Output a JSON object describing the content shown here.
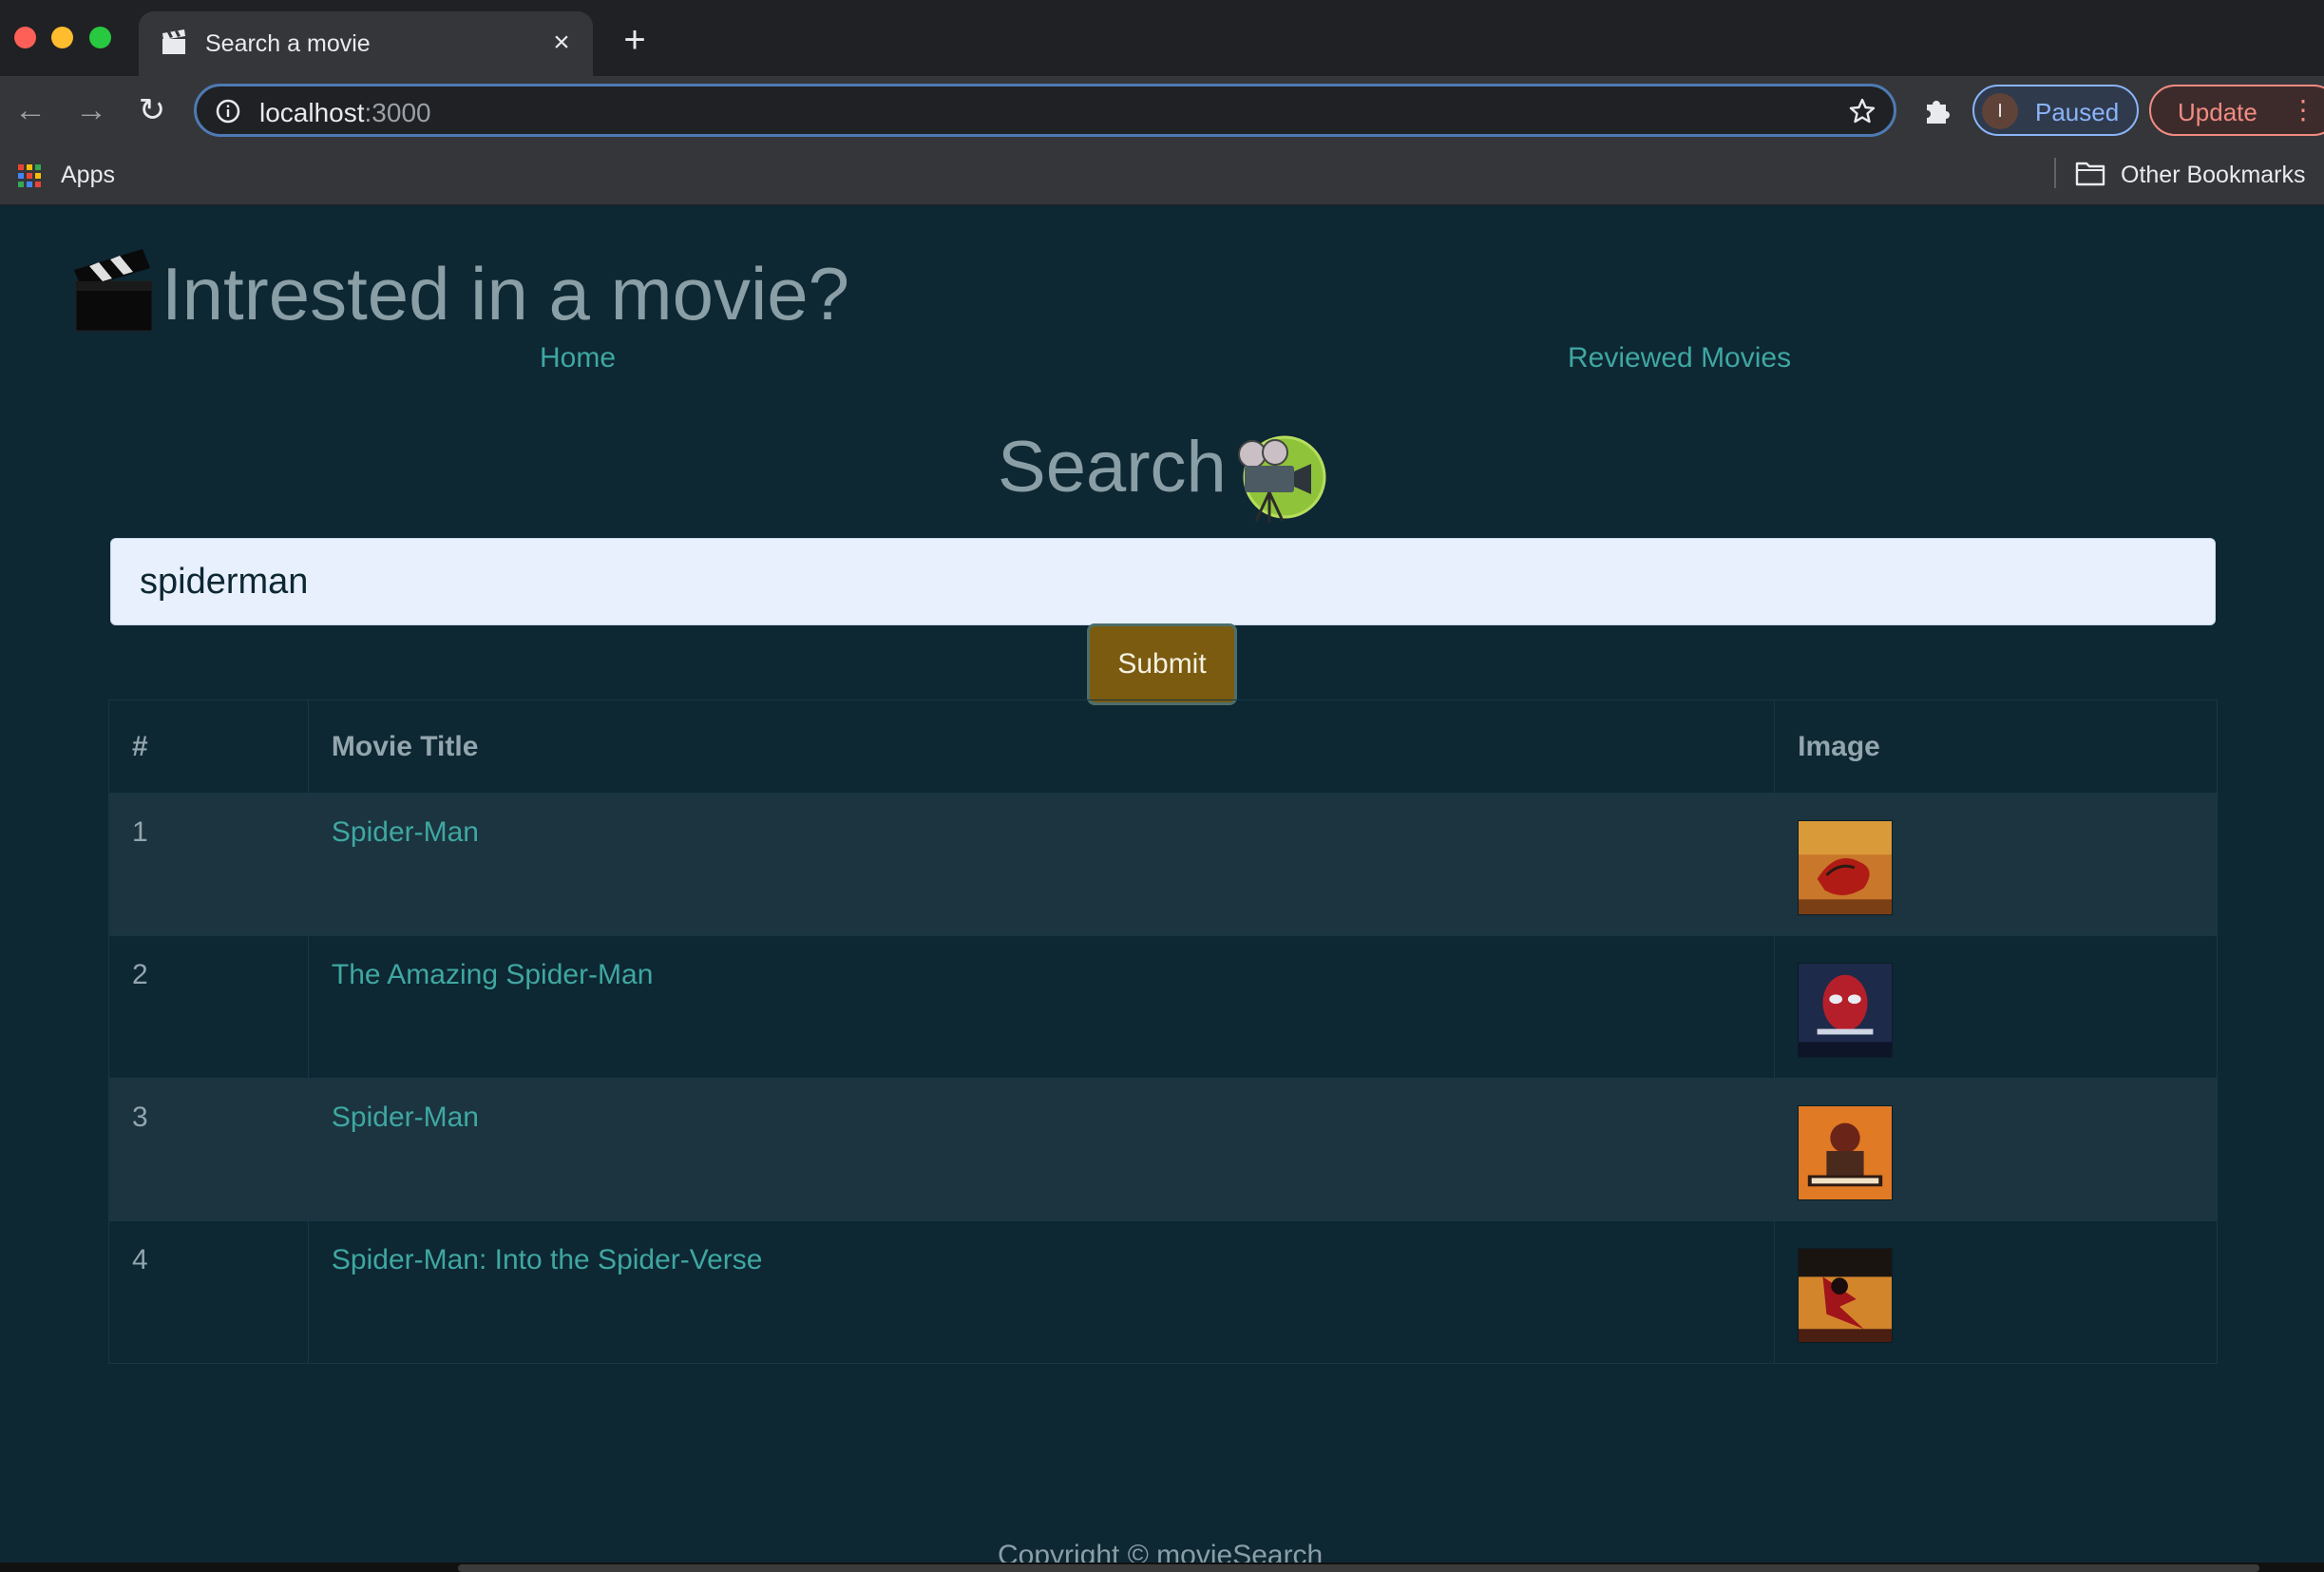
{
  "browser": {
    "tab_title": "Search a movie",
    "tab_close_glyph": "×",
    "new_tab_glyph": "+",
    "url_host": "localhost",
    "url_port": ":3000",
    "profile_initial": "I",
    "profile_status": "Paused",
    "update_label": "Update",
    "bookmarks_apps": "Apps",
    "bookmarks_other": "Other Bookmarks"
  },
  "header": {
    "brand_title": "Intrested in a movie?",
    "brand_icon": "clapperboard-icon",
    "nav": {
      "home": "Home",
      "reviewed": "Reviewed Movies"
    }
  },
  "search": {
    "heading": "Search",
    "heading_icon": "movie-camera-icon",
    "query": "spiderman",
    "submit_label": "Submit"
  },
  "results": {
    "columns": [
      "#",
      "Movie Title",
      "Image"
    ],
    "rows": [
      {
        "num": "1",
        "title": "Spider-Man"
      },
      {
        "num": "2",
        "title": "The Amazing Spider-Man"
      },
      {
        "num": "3",
        "title": "Spider-Man"
      },
      {
        "num": "4",
        "title": "Spider-Man: Into the Spider-Verse"
      }
    ]
  },
  "footer": {
    "copyright": "Copyright © movieSearch"
  },
  "colors": {
    "page_bg": "#0d2733",
    "link": "#3fa7a2",
    "submit_bg": "#7a5b10",
    "input_bg": "#e8f0fe"
  }
}
